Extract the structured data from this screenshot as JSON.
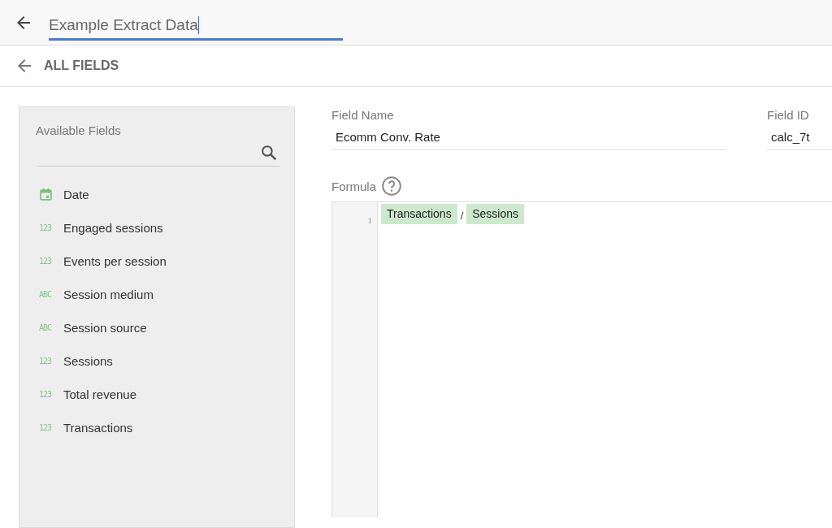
{
  "header": {
    "title_value": "Example Extract Data"
  },
  "breadcrumb": {
    "label": "ALL FIELDS"
  },
  "available_fields": {
    "title": "Available Fields",
    "items": [
      {
        "kind": "date",
        "name": "Date"
      },
      {
        "kind": "number",
        "type_label": "123",
        "name": "Engaged sessions"
      },
      {
        "kind": "number",
        "type_label": "123",
        "name": "Events per session"
      },
      {
        "kind": "text",
        "type_label": "ABC",
        "name": "Session medium"
      },
      {
        "kind": "text",
        "type_label": "ABC",
        "name": "Session source"
      },
      {
        "kind": "number",
        "type_label": "123",
        "name": "Sessions"
      },
      {
        "kind": "number",
        "type_label": "123",
        "name": "Total revenue"
      },
      {
        "kind": "number",
        "type_label": "123",
        "name": "Transactions"
      }
    ]
  },
  "field_name": {
    "label": "Field Name",
    "value": "Ecomm Conv. Rate"
  },
  "field_id": {
    "label": "Field ID",
    "value": "calc_7t"
  },
  "formula": {
    "label": "Formula",
    "line_number": "1",
    "tokens": [
      {
        "kind": "field",
        "text": "Transactions"
      },
      {
        "kind": "operator",
        "text": "/"
      },
      {
        "kind": "field",
        "text": "Sessions"
      }
    ]
  }
}
